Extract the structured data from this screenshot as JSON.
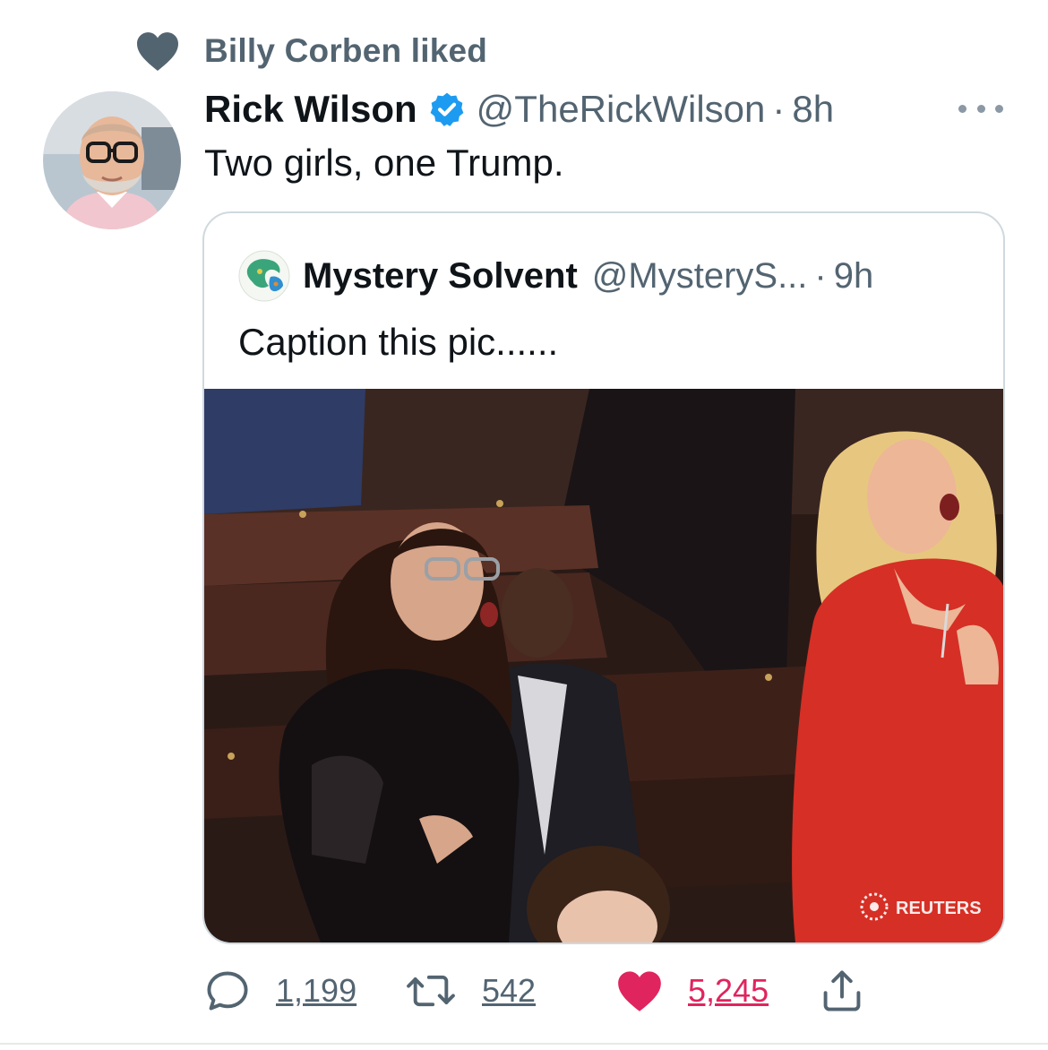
{
  "social_context": {
    "icon": "heart-icon",
    "text": "Billy Corben liked"
  },
  "tweet": {
    "author_name": "Rick Wilson",
    "verified": true,
    "handle": "@TheRickWilson",
    "separator": "·",
    "time": "8h",
    "text": "Two girls, one Trump.",
    "more_icon": "more-dots-icon"
  },
  "quoted_tweet": {
    "author_name": "Mystery Solvent",
    "handle": "@MysteryS...",
    "separator": "·",
    "time": "9h",
    "text": "Caption this pic......",
    "photo_watermark": "REUTERS"
  },
  "actions": {
    "replies": "1,199",
    "retweets": "542",
    "likes": "5,245",
    "share_icon": "share-icon"
  },
  "colors": {
    "text_primary": "#0f1419",
    "text_secondary": "#536471",
    "verified_blue": "#1d9bf0",
    "like_pink": "#e0245e",
    "border": "#cfd9de"
  }
}
